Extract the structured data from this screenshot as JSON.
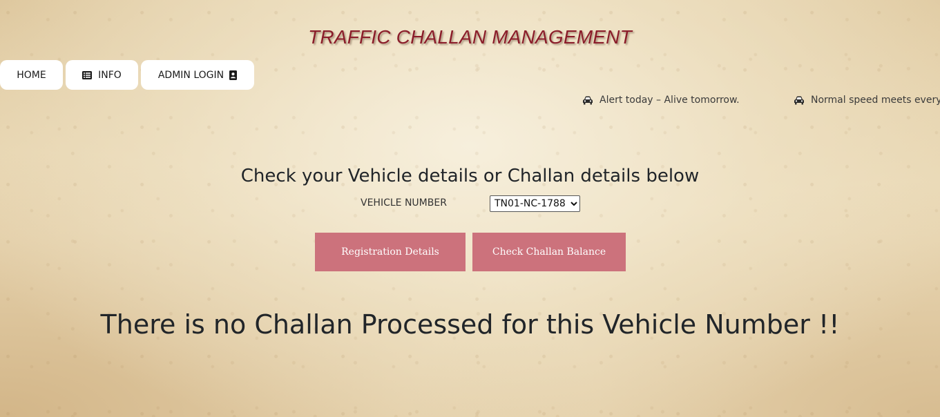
{
  "site": {
    "title": "TRAFFIC CHALLAN MANAGEMENT"
  },
  "nav": {
    "home_label": "HOME",
    "info_label": "INFO",
    "admin_label": "ADMIN LOGIN",
    "info_icon": "list-icon",
    "admin_icon": "contact-card-icon"
  },
  "ticker": {
    "items": [
      {
        "icon": "car-icon",
        "text": "Alert today – Alive tomorrow."
      },
      {
        "icon": "car-icon",
        "text": "Normal speed meets every"
      }
    ]
  },
  "main": {
    "heading": "Check your Vehicle details or Challan details below",
    "vehicle_label": "VEHICLE NUMBER",
    "vehicle_selected": "TN01-NC-1788",
    "registration_button": "Registration Details",
    "challan_button": "Check Challan Balance",
    "result_message": "There is no Challan Processed for this Vehicle Number !!"
  },
  "colors": {
    "title": "#8b1d2a",
    "button_bg": "#cc727c",
    "button_text": "#ffffff",
    "nav_bg": "#ffffff"
  }
}
